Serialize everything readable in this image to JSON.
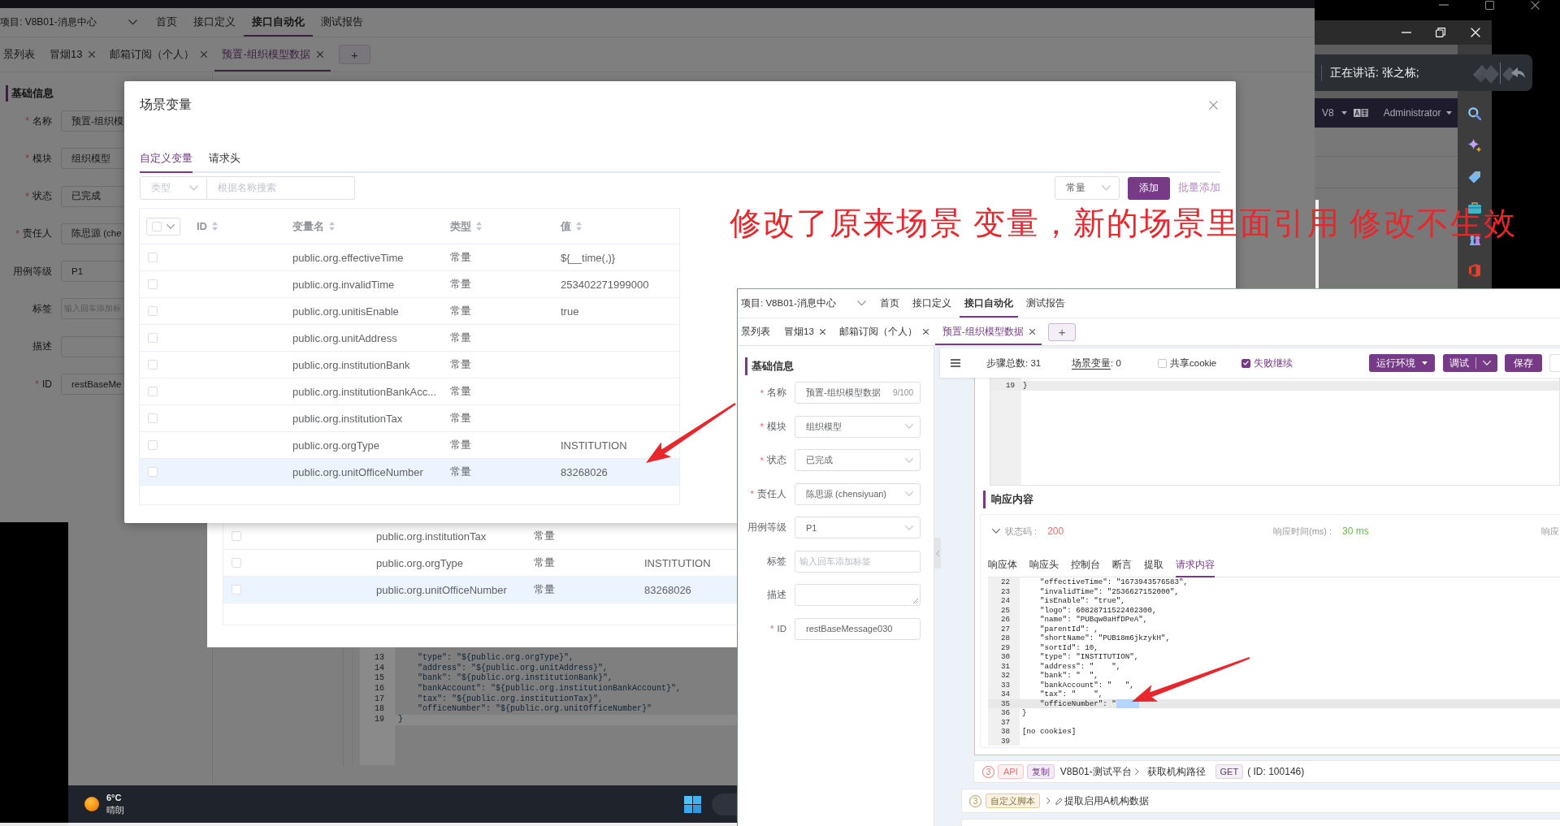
{
  "background_app": {
    "project": "项目: V8B01-消息中心",
    "nav": [
      {
        "label": "首页",
        "selected": false
      },
      {
        "label": "接口定义",
        "selected": false
      },
      {
        "label": "接口自动化",
        "selected": true
      },
      {
        "label": "测试报告",
        "selected": false
      }
    ],
    "tabs": [
      {
        "label": "景列表",
        "closable": false,
        "selected": false
      },
      {
        "label": "冒烟13",
        "closable": true,
        "selected": false
      },
      {
        "label": "邮箱订阅（个人）",
        "closable": true,
        "selected": false
      },
      {
        "label": "预置-组织模型数据",
        "closable": true,
        "selected": true
      }
    ],
    "add_tab": "+",
    "section_title": "基础信息",
    "fields": [
      {
        "required_mark": "*",
        "label": "名称",
        "value": "预置-组织模"
      },
      {
        "required_mark": "*",
        "label": "模块",
        "value": "组织模型"
      },
      {
        "required_mark": "*",
        "label": "状态",
        "value": "已完成"
      },
      {
        "required_mark": "*",
        "label": "责任人",
        "value": "陈思源 (che"
      },
      {
        "label": "用例等级",
        "value": "P1"
      },
      {
        "label": "标签",
        "placeholder": "输入回车添加标"
      },
      {
        "label": "描述"
      },
      {
        "required_mark": "*",
        "label": "ID",
        "value": "restBaseMe"
      }
    ],
    "code_lines": [
      {
        "number": "13",
        "text": "    \"type\": \"${public.org.orgType}\",",
        "current": false
      },
      {
        "number": "14",
        "text": "    \"address\": \"${public.org.unitAddress}\",",
        "current": false
      },
      {
        "number": "15",
        "text": "    \"bank\": \"${public.org.institutionBank}\",",
        "current": false
      },
      {
        "number": "16",
        "text": "    \"bankAccount\": \"${public.org.institutionBankAccount}\",",
        "current": false
      },
      {
        "number": "17",
        "text": "    \"tax\": \"${public.org.institutionTax}\",",
        "current": false
      },
      {
        "number": "18",
        "text": "    \"officeNumber\": \"${public.org.unitOfficeNumber}\"",
        "current": false
      },
      {
        "number": "19",
        "text": "}",
        "current": true
      }
    ]
  },
  "behind_table": {
    "rows": [
      {
        "checked": false,
        "selected": false,
        "name": "public.org.institutionTax",
        "type": "常量"
      },
      {
        "checked": false,
        "selected": false,
        "name": "public.org.orgType",
        "type": "常量",
        "value": "INSTITUTION"
      },
      {
        "checked": false,
        "selected": true,
        "name": "public.org.unitOfficeNumber",
        "type": "常量",
        "value": "83268026"
      }
    ]
  },
  "variables_dialog": {
    "title": "场景变量",
    "tabs": [
      {
        "label": "自定义变量",
        "selected": true
      },
      {
        "label": "请求头",
        "selected": false
      }
    ],
    "type_filter": {
      "placeholder": "类型"
    },
    "search": {
      "placeholder": "根据名称搜索"
    },
    "type_select": {
      "value": "常量"
    },
    "add_button": "添加",
    "batch_add_link": "批量添加",
    "select_all": {
      "checked": false
    },
    "columns": [
      {
        "label": "ID",
        "sortable": true
      },
      {
        "label": "变量名",
        "sortable": true
      },
      {
        "label": "类型",
        "sortable": true
      },
      {
        "label": "值",
        "sortable": true
      }
    ],
    "rows": [
      {
        "checked": false,
        "selected": false,
        "name": "public.org.effectiveTime",
        "type": "常量",
        "value": "${__time(,)}"
      },
      {
        "checked": false,
        "selected": false,
        "name": "public.org.invalidTime",
        "type": "常量",
        "value": "253402271999000"
      },
      {
        "checked": false,
        "selected": false,
        "name": "public.org.unitisEnable",
        "type": "常量",
        "value": "true"
      },
      {
        "checked": false,
        "selected": false,
        "name": "public.org.unitAddress",
        "type": "常量"
      },
      {
        "checked": false,
        "selected": false,
        "name": "public.org.institutionBank",
        "type": "常量"
      },
      {
        "checked": false,
        "selected": false,
        "name": "public.org.institutionBankAcc...",
        "type": "常量"
      },
      {
        "checked": false,
        "selected": false,
        "name": "public.org.institutionTax",
        "type": "常量"
      },
      {
        "checked": false,
        "selected": false,
        "name": "public.org.orgType",
        "type": "常量",
        "value": "INSTITUTION"
      },
      {
        "checked": false,
        "selected": true,
        "name": "public.org.unitOfficeNumber",
        "type": "常量",
        "value": "83268026"
      }
    ]
  },
  "annotation": "修改了原来场景 变量，新的场景里面引用 修改不生效",
  "meeting_popup": {
    "speaking": "正在讲话: 张之栋;"
  },
  "admin_bar": {
    "version": "V8",
    "user": "Administrator"
  },
  "inset": {
    "project": "项目: V8B01-消息中心",
    "nav": [
      {
        "label": "首页",
        "selected": false
      },
      {
        "label": "接口定义",
        "selected": false
      },
      {
        "label": "接口自动化",
        "selected": true
      },
      {
        "label": "测试报告",
        "selected": false
      }
    ],
    "tabs": [
      {
        "label": "景列表",
        "closable": false,
        "selected": false
      },
      {
        "label": "冒烟13",
        "closable": true,
        "selected": false
      },
      {
        "label": "邮箱订阅（个人）",
        "closable": true,
        "selected": false
      },
      {
        "label": "预置-组织模型数据",
        "closable": true,
        "selected": true
      }
    ],
    "add_tab": "+",
    "section_title": "基础信息",
    "fields": [
      {
        "kind": "input",
        "required_mark": "*",
        "label": "名称",
        "value": "预置-组织模型数据",
        "counter": "9/100"
      },
      {
        "kind": "select",
        "required_mark": "*",
        "label": "模块",
        "value": "组织模型"
      },
      {
        "kind": "select",
        "required_mark": "*",
        "label": "状态",
        "value": "已完成"
      },
      {
        "kind": "select",
        "required_mark": "*",
        "label": "责任人",
        "value": "陈思源 (chensiyuan)"
      },
      {
        "kind": "select",
        "label": "用例等级",
        "value": "P1"
      },
      {
        "kind": "tags",
        "label": "标签",
        "placeholder": "输入回车添加标签"
      },
      {
        "kind": "textarea",
        "label": "描述"
      },
      {
        "kind": "input",
        "required_mark": "*",
        "label": "ID",
        "value": "restBaseMessage030"
      }
    ],
    "toolbar": {
      "steps": "步骤总数: 31",
      "variables_link": "场景变量",
      "variables_count": ": 0",
      "options": [
        {
          "label": "共享cookie",
          "checked": false
        },
        {
          "label": "失败继续",
          "checked": true
        }
      ],
      "buttons": [
        {
          "kind": "dropdown",
          "label": "运行环境"
        },
        {
          "kind": "split",
          "label": "调试"
        },
        {
          "kind": "plain",
          "label": "保存"
        }
      ]
    },
    "editor_lines": [
      {
        "number": "19",
        "text": "}",
        "current": true
      }
    ],
    "response": {
      "title": "响应内容",
      "status_label": "状态码 :",
      "status": "200",
      "time_label": "响应时间(ms) :",
      "time": "30 ms",
      "more_label": "响应",
      "tabs": [
        {
          "label": "响应体",
          "selected": false
        },
        {
          "label": "响应头",
          "selected": false
        },
        {
          "label": "控制台",
          "selected": false
        },
        {
          "label": "断言",
          "selected": false
        },
        {
          "label": "提取",
          "selected": false
        },
        {
          "label": "请求内容",
          "selected": true
        }
      ],
      "lines": [
        {
          "number": "22",
          "text": "    \"effectiveTime\": \"1673943576583\",",
          "current": false,
          "has_selection": false
        },
        {
          "number": "23",
          "text": "    \"invalidTime\": \"2536627152000\",",
          "current": false,
          "has_selection": false
        },
        {
          "number": "24",
          "text": "    \"isEnable\": \"true\",",
          "current": false,
          "has_selection": false
        },
        {
          "number": "25",
          "text": "    \"logo\": 60828711522402300,",
          "current": false,
          "has_selection": false
        },
        {
          "number": "26",
          "text": "    \"name\": \"PUBqw0aHfDPeA\",",
          "current": false,
          "has_selection": false
        },
        {
          "number": "27",
          "text": "    \"parentId\": ,",
          "current": false,
          "has_selection": false
        },
        {
          "number": "28",
          "text": "    \"shortName\": \"PUB18m6jkzykH\",",
          "current": false,
          "has_selection": false
        },
        {
          "number": "29",
          "text": "    \"sortId\": 10,",
          "current": false,
          "has_selection": false
        },
        {
          "number": "30",
          "text": "    \"type\": \"INSTITUTION\",",
          "current": false,
          "has_selection": false
        },
        {
          "number": "31",
          "text": "    \"address\": \"    \",",
          "current": false,
          "has_selection": false
        },
        {
          "number": "32",
          "text": "    \"bank\": \"  \",",
          "current": false,
          "has_selection": false
        },
        {
          "number": "33",
          "text": "    \"bankAccount\": \"   \",",
          "current": false,
          "has_selection": false
        },
        {
          "number": "34",
          "text": "    \"tax\": \"    \",",
          "current": false,
          "has_selection": false
        },
        {
          "number": "35",
          "text": "    \"officeNumber\": \"",
          "current": true,
          "has_selection": true
        },
        {
          "number": "36",
          "text": "}",
          "current": false,
          "has_selection": false
        },
        {
          "number": "37",
          "current": false,
          "has_selection": false
        },
        {
          "number": "38",
          "text": "[no cookies]",
          "current": false,
          "has_selection": false
        },
        {
          "number": "39",
          "current": false,
          "has_selection": false
        }
      ]
    },
    "steps": [
      {
        "kind": "api",
        "number": "3",
        "type_tag": "API",
        "copy_tag": "复制",
        "project": "V8B01-测试平台",
        "name": "获取机构路径",
        "method": "GET",
        "id": "( ID: 100146)"
      },
      {
        "kind": "script",
        "number": "3",
        "type_tag": "自定义脚本",
        "name": "提取启用A机构数据"
      }
    ]
  },
  "taskbar": {
    "temperature": "6°C",
    "weather": "晴朗"
  }
}
